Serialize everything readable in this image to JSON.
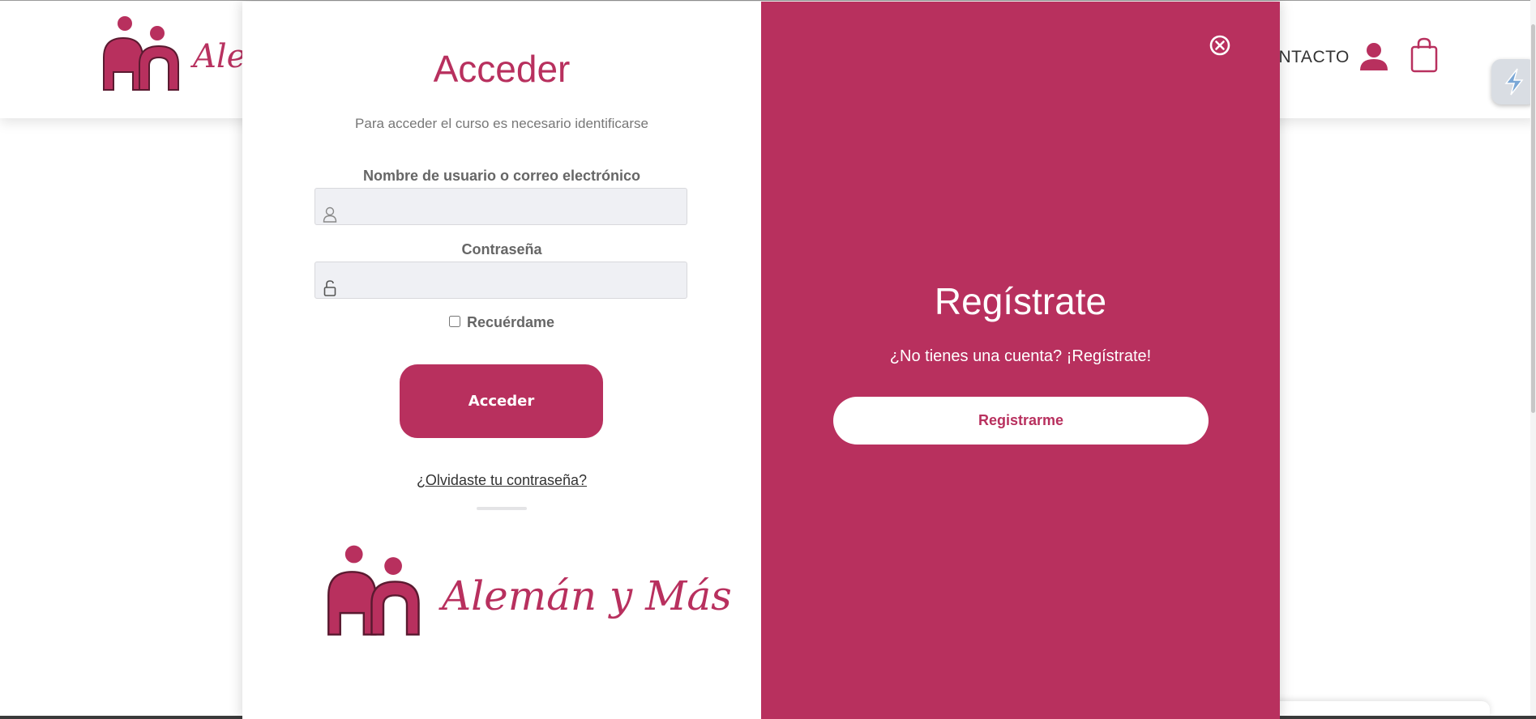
{
  "header": {
    "logo_text": "Alemán y Más",
    "nav_contacto": "CONTACTO",
    "accent_color": "#b8305e"
  },
  "modal": {
    "login": {
      "title": "Acceder",
      "subtitle": "Para acceder el curso es necesario identificarse",
      "username_label": "Nombre de usuario o correo electrónico",
      "username_value": "",
      "password_label": "Contraseña",
      "password_value": "",
      "remember_label": "Recuérdame",
      "remember_checked": false,
      "submit_label": "Acceder",
      "forgot_link": "¿Olvidaste tu contraseña?",
      "footer_logo_text": "Alemán y Más"
    },
    "register": {
      "title": "Regístrate",
      "subtitle": "¿No tienes una cuenta? ¡Regístrate!",
      "button_label": "Registrarme"
    },
    "close_icon": "close-circle-icon"
  },
  "icons": {
    "user": "user-icon",
    "cart": "shopping-bag-icon",
    "username_field": "user-outline-icon",
    "password_field": "lock-open-icon",
    "extension": "lightning-extension-icon"
  },
  "colors": {
    "primary": "#b8305e",
    "field_bg": "#eff0f4",
    "text_gray": "#666666"
  }
}
